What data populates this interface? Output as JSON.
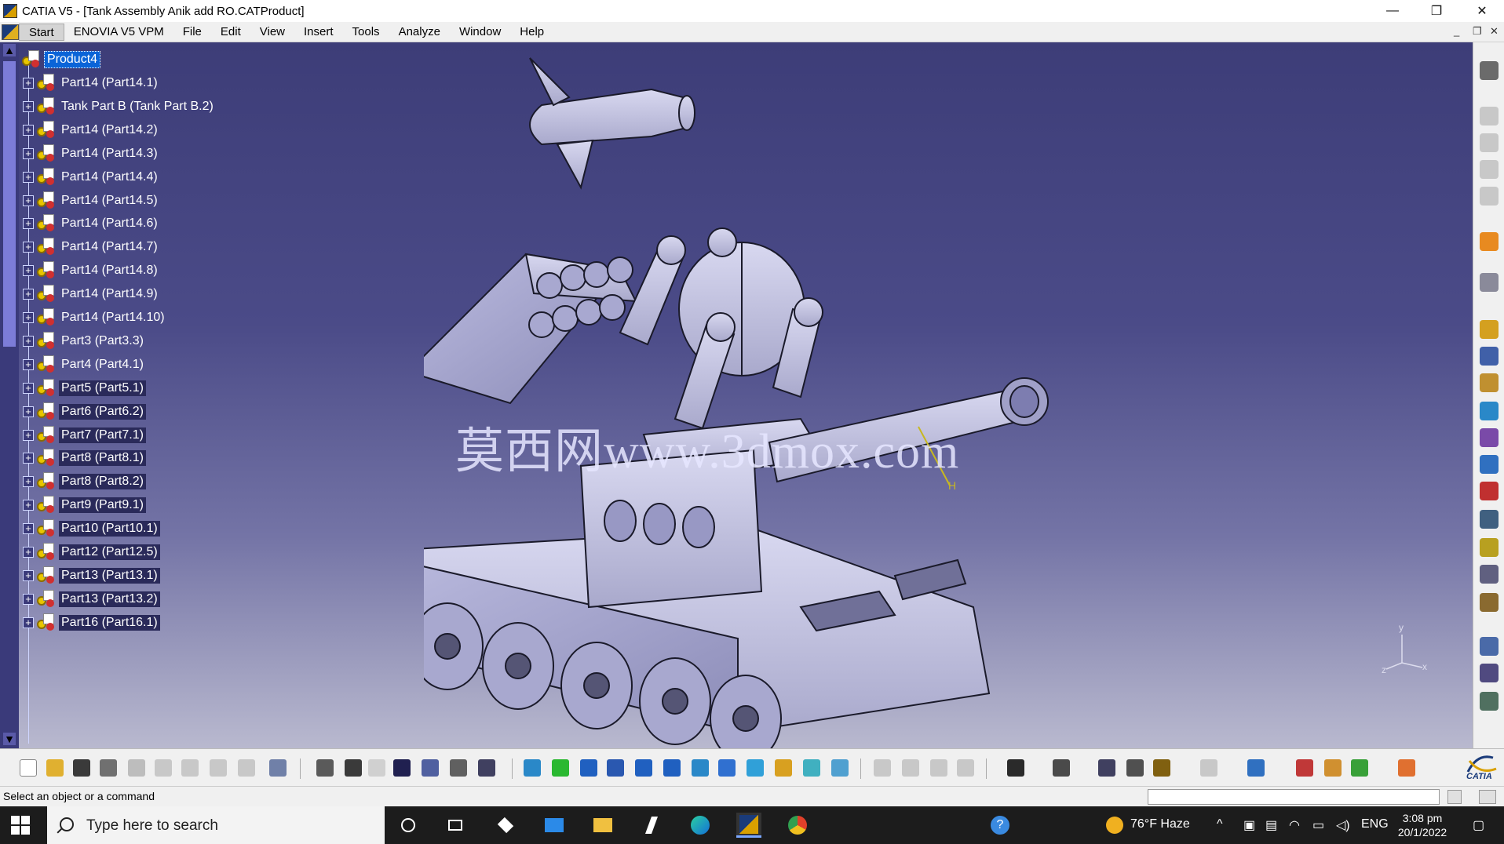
{
  "window": {
    "title": "CATIA V5 - [Tank Assembly Anik add  RO.CATProduct]",
    "controls": {
      "minimize": "—",
      "restore": "❐",
      "close": "✕"
    }
  },
  "menubar": {
    "items": [
      "Start",
      "ENOVIA V5 VPM",
      "File",
      "Edit",
      "View",
      "Insert",
      "Tools",
      "Analyze",
      "Window",
      "Help"
    ],
    "doc_controls": {
      "minimize": "_",
      "restore": "❐",
      "close": "✕"
    }
  },
  "tree": {
    "root": "Product4",
    "nodes": [
      "Part14 (Part14.1)",
      "Tank Part B (Tank Part B.2)",
      "Part14 (Part14.2)",
      "Part14 (Part14.3)",
      "Part14 (Part14.4)",
      "Part14 (Part14.5)",
      "Part14 (Part14.6)",
      "Part14 (Part14.7)",
      "Part14 (Part14.8)",
      "Part14 (Part14.9)",
      "Part14 (Part14.10)",
      "Part3 (Part3.3)",
      "Part4 (Part4.1)",
      "Part5 (Part5.1)",
      "Part6 (Part6.2)",
      "Part7 (Part7.1)",
      "Part8 (Part8.1)",
      "Part8 (Part8.2)",
      "Part9 (Part9.1)",
      "Part10 (Part10.1)",
      "Part12 (Part12.5)",
      "Part13 (Part13.1)",
      "Part13 (Part13.2)",
      "Part16 (Part16.1)"
    ]
  },
  "viewport": {
    "watermark": "莫西网www.3dmox.com",
    "axis": {
      "x": "x",
      "y": "y",
      "z": "z"
    },
    "annotations": {
      "h": "H"
    }
  },
  "status": {
    "message": "Select an object or a command"
  },
  "taskbar": {
    "search_placeholder": "Type here to search",
    "weather": "76°F  Haze",
    "language": "ENG",
    "time": "3:08 pm",
    "date": "20/1/2022"
  },
  "colors": {
    "viewport_top": "#3d3d78",
    "viewport_bottom": "#b9b9cf",
    "selection": "#0a64d8",
    "model": "#c9c9e6"
  }
}
